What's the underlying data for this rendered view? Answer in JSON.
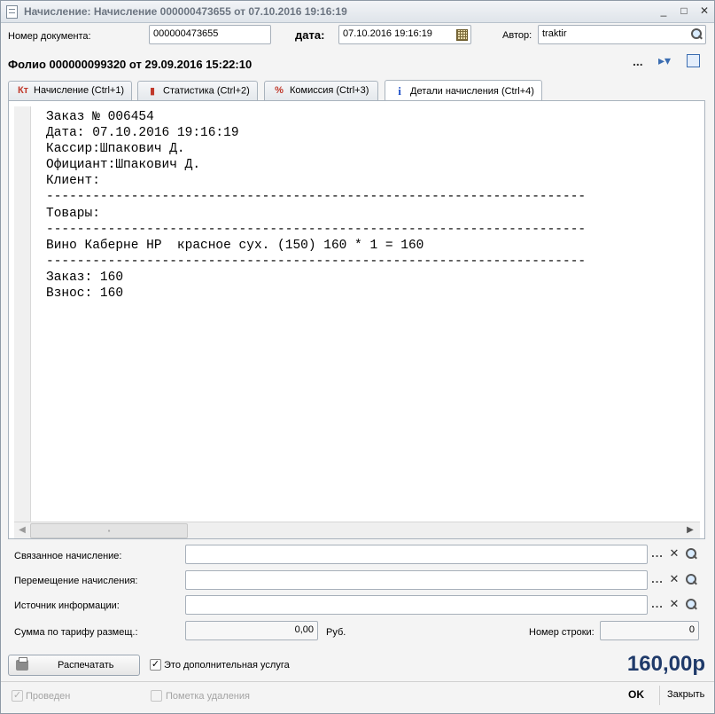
{
  "window": {
    "title": "Начисление: Начисление 000000473655 от 07.10.2016 19:16:19",
    "min_label": "_",
    "max_label": "□",
    "close_label": "✕"
  },
  "header": {
    "doc_number_label": "Номер документа:",
    "doc_number_value": "000000473655",
    "date_label": "дата:",
    "date_value": "07.10.2016 19:16:19",
    "author_label": "Автор:",
    "author_value": "traktir",
    "folio": "Фолио 000000099320 от 29.09.2016 15:22:10",
    "more_label": "...",
    "nav_label": "▸▾"
  },
  "tabs": [
    {
      "icon_text": "Кт",
      "label": "Начисление (Ctrl+1)"
    },
    {
      "icon_text": "▮",
      "label": "Статистика (Ctrl+2)"
    },
    {
      "icon_text": "%",
      "label": "Комиссия (Ctrl+3)"
    },
    {
      "icon_text": "i",
      "label": "Детали начисления (Ctrl+4)"
    }
  ],
  "receipt_lines": [
    "Заказ № 006454",
    "Дата: 07.10.2016 19:16:19",
    "Кассир:Шпакович Д.",
    "Официант:Шпакович Д.",
    "Клиент:",
    "----------------------------------------------------------------------",
    "Товары:",
    "----------------------------------------------------------------------",
    "Вино Каберне HP  красное сух. (150) 160 * 1 = 160",
    "----------------------------------------------------------------------",
    "Заказ: 160",
    "Взнос: 160"
  ],
  "scroll": {
    "left": "◀",
    "right": "▶",
    "thumb": "▪"
  },
  "form": {
    "linked_label": "Связанное начисление:",
    "move_label": "Перемещение начисления:",
    "source_label": "Источник информации:",
    "sum_label": "Сумма по тарифу размещ.:",
    "sum_value": "0,00",
    "currency": "Руб.",
    "row_number_label": "Номер строки:",
    "row_number_value": "0",
    "ellipsis": "...",
    "clear": "✕"
  },
  "footer": {
    "print_label": "Распечатать",
    "extra_service_label": "Это дополнительная услуга",
    "extra_service_checked": "✓",
    "total": "160,00р",
    "posted_label": "Проведен",
    "posted_checked": "✓",
    "deletion_label": "Пометка удаления",
    "ok_label": "OK",
    "close_label": "Закрыть"
  }
}
